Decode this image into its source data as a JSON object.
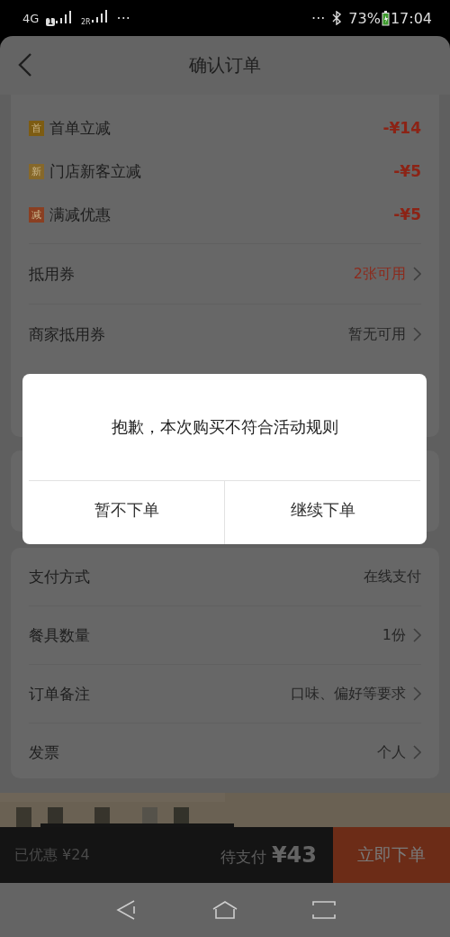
{
  "status_bar": {
    "network": "4G",
    "sim1": "1",
    "sim2": "2R",
    "more_left": "···",
    "more_right": "···",
    "battery": "73%",
    "time": "17:04"
  },
  "header": {
    "title": "确认订单"
  },
  "discounts": [
    {
      "badge": "首",
      "label": "首单立减",
      "amount": "-¥14",
      "color": "#7d5c12"
    },
    {
      "badge": "新",
      "label": "门店新客立减",
      "amount": "-¥5",
      "color": "#86682a"
    },
    {
      "badge": "减",
      "label": "满减优惠",
      "amount": "-¥5",
      "color": "#8a3f22"
    }
  ],
  "coupons": [
    {
      "label": "抵用券",
      "value": "2张可用",
      "highlighted": true
    },
    {
      "label": "商家抵用券",
      "value": "暂无可用",
      "highlighted": false
    }
  ],
  "dialog": {
    "message": "抱歉，本次购买不符合活动规则",
    "buttons": [
      "暂不下单",
      "继续下单"
    ]
  },
  "order_options": [
    {
      "label": "支付方式",
      "value": "在线支付",
      "has_arrow": false
    },
    {
      "label": "餐具数量",
      "value": "1份",
      "has_arrow": true
    },
    {
      "label": "订单备注",
      "value": "口味、偏好等要求",
      "has_arrow": true
    },
    {
      "label": "发票",
      "value": "个人",
      "has_arrow": true
    }
  ],
  "bottom_bar": {
    "saved": "已优惠 ¥24",
    "due_label": "待支付",
    "due_amount": "¥43",
    "submit": "立即下单"
  }
}
